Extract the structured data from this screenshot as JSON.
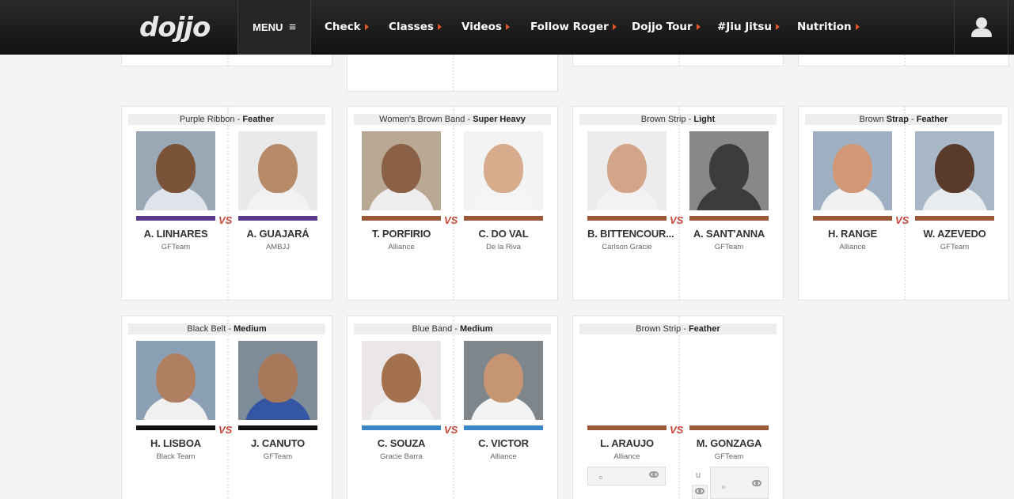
{
  "nav": {
    "logo": "dojjo",
    "menu_label": "MENU",
    "menu_icon": "≡",
    "items": [
      {
        "label": "Check"
      },
      {
        "label": "Classes"
      },
      {
        "label": "Videos"
      },
      {
        "label": "Follow Roger"
      },
      {
        "label": "Dojjo Tour"
      },
      {
        "label": "#Jiu Jitsu"
      },
      {
        "label": "Nutrition"
      }
    ],
    "user_icon": "user-icon"
  },
  "vs_label": "VS",
  "matches": [
    {
      "title_prefix": "Purple Ribbon - ",
      "title_bold": "Feather",
      "fighters": [
        {
          "name": "A. LINHARES",
          "team": "GFTeam",
          "belt_color": "#5b3a8c",
          "skin": "#7a5238",
          "gi": "#dfe4ea",
          "bg": "#9aa7b4"
        },
        {
          "name": "A. GUAJARÁ",
          "team": "AMBJJ",
          "belt_color": "#5b3a8c",
          "skin": "#b78a6a",
          "gi": "#f2f2f2",
          "bg": "#e9e9e9"
        }
      ]
    },
    {
      "title_prefix": "Women's Brown Band - ",
      "title_bold": "Super Heavy",
      "fighters": [
        {
          "name": "T. PORFIRIO",
          "team": "Alliance",
          "belt_color": "#9b5a36",
          "skin": "#8a6046",
          "gi": "#eeeeee",
          "bg": "#b9a994"
        },
        {
          "name": "C. DO VAL",
          "team": "De la Riva",
          "belt_color": "#9b5a36",
          "skin": "#d7ac8c",
          "gi": "#f5f5f5",
          "bg": "#f3f3f3"
        }
      ]
    },
    {
      "title_prefix": "Brown Strip - ",
      "title_bold": "Light",
      "fighters": [
        {
          "name": "B. BITTENCOUR...",
          "team": "Carlson Gracie",
          "belt_color": "#9b5a36",
          "skin": "#d3a487",
          "gi": "#f2f2f2",
          "bg": "#ececec"
        },
        {
          "name": "A. SANT'ANNA",
          "team": "GFTeam",
          "belt_color": "#9b5a36",
          "skin": "#3c3c3c",
          "gi": "#3c3c3c",
          "bg": "#888888"
        }
      ]
    },
    {
      "title_prefix": "Brown ",
      "title_bold": "Strap",
      "title_mid": " - ",
      "title_bold2": "Feather",
      "fighters": [
        {
          "name": "H. RANGE",
          "team": "Alliance",
          "belt_color": "#9b5a36",
          "skin": "#d29876",
          "gi": "#f1f1f1",
          "bg": "#9eb0c2"
        },
        {
          "name": "W. AZEVEDO",
          "team": "GFTeam",
          "belt_color": "#9b5a36",
          "skin": "#5a3a2a",
          "gi": "#e9ecef",
          "bg": "#a9b8c6"
        }
      ]
    },
    {
      "title_prefix": "Black Belt - ",
      "title_bold": "Medium",
      "fighters": [
        {
          "name": "H. LISBOA",
          "team": "Black Team",
          "belt_color": "#111111",
          "skin": "#b07e60",
          "gi": "#f0f0f0",
          "bg": "#8ba0b4"
        },
        {
          "name": "J. CANUTO",
          "team": "GFTeam",
          "belt_color": "#111111",
          "skin": "#a8785a",
          "gi": "#3557a3",
          "bg": "#7f8c99"
        }
      ]
    },
    {
      "title_prefix": "Blue Band - ",
      "title_bold": "Medium",
      "fighters": [
        {
          "name": "C. SOUZA",
          "team": "Gracie Barra",
          "belt_color": "#3b86c6",
          "skin": "#a4714f",
          "gi": "#f2f2f2",
          "bg": "#ebe7e9"
        },
        {
          "name": "C. VICTOR",
          "team": "Alliance",
          "belt_color": "#3b86c6",
          "skin": "#c59574",
          "gi": "#f3f3f3",
          "bg": "#7e858b"
        }
      ]
    },
    {
      "title_prefix": "Brown Strip - ",
      "title_bold": "Feather",
      "fighters": [
        {
          "name": "L. ARAUJO",
          "team": "Alliance",
          "belt_color": "#9b5a36",
          "skin": "",
          "gi": "",
          "bg": ""
        },
        {
          "name": "M. GONZAGA",
          "team": "GFTeam",
          "belt_color": "#9b5a36",
          "skin": "",
          "gi": "",
          "bg": ""
        }
      ]
    }
  ],
  "bet_widgets": {
    "dot_label": "o",
    "u_label": "u"
  }
}
